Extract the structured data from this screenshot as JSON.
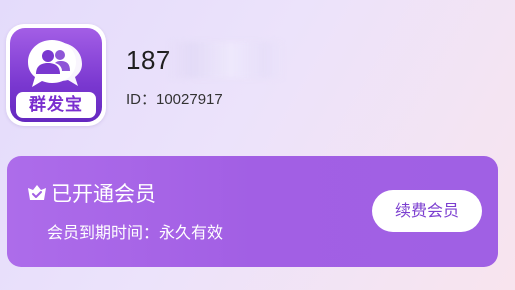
{
  "app": {
    "logo_text": "群发宝",
    "logo_icon": "chat-bubble-users-icon"
  },
  "user": {
    "phone_prefix": "187",
    "id_text": "ID：10027917"
  },
  "membership": {
    "status_icon": "crown-icon",
    "status": "已开通会员",
    "expiry": "会员到期时间：永久有效",
    "renew_label": "续费会员"
  },
  "colors": {
    "accent": "#a25fe4",
    "card_button_text": "#7c3fd0"
  }
}
